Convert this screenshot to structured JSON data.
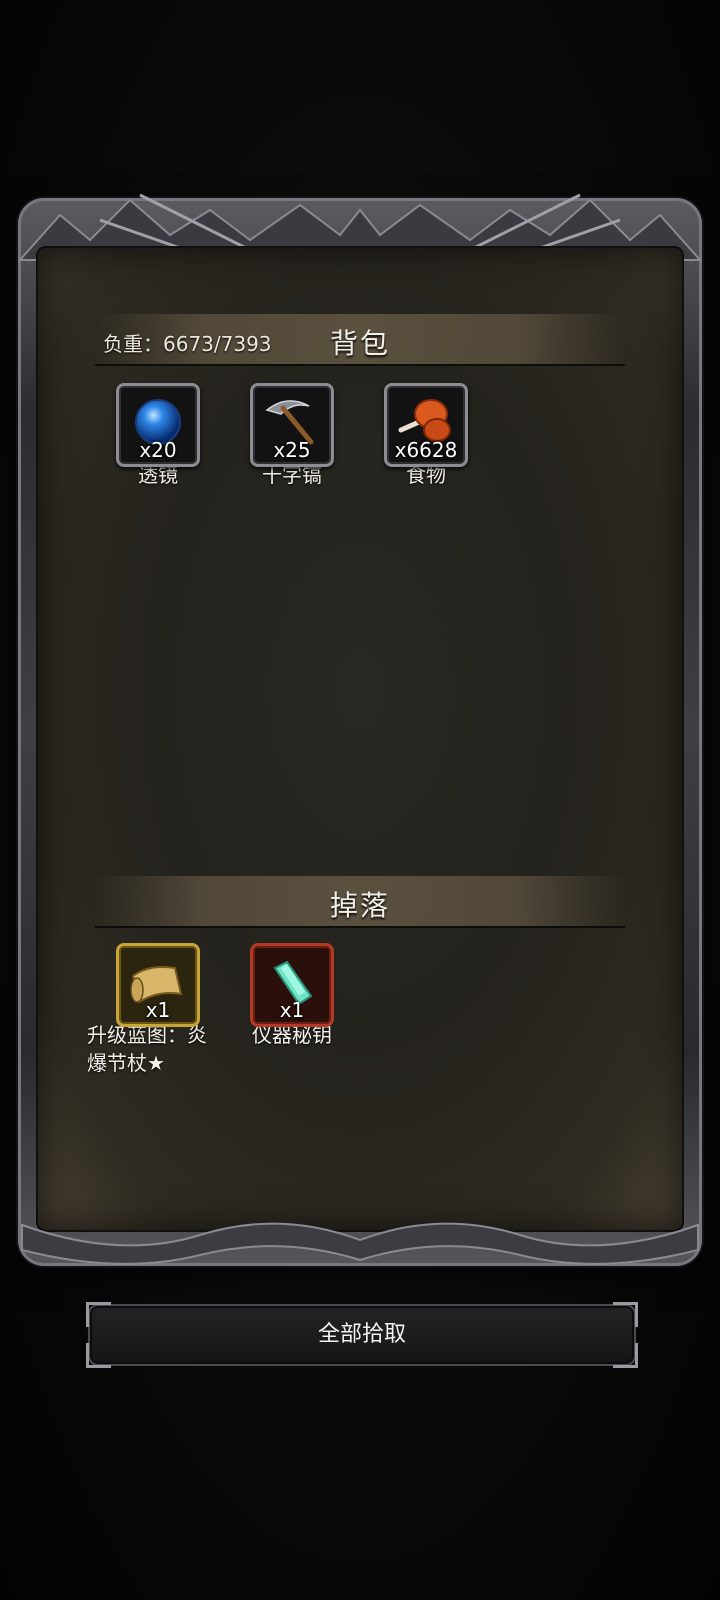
{
  "bag": {
    "weight_label": "负重：6673/7393",
    "title": "背包",
    "items": [
      {
        "name": "透镜",
        "count": "x20",
        "icon": "blue-orb-icon"
      },
      {
        "name": "十字镐",
        "count": "x25",
        "icon": "pickaxe-icon"
      },
      {
        "name": "食物",
        "count": "x6628",
        "icon": "meat-drumstick-icon"
      }
    ]
  },
  "drops": {
    "title": "掉落",
    "items": [
      {
        "name": "升级蓝图：炎爆节杖★",
        "count": "x1",
        "icon": "scroll-blueprint-icon",
        "rarity_color": "#c9a437"
      },
      {
        "name": "仪器秘钥",
        "count": "x1",
        "icon": "crystal-key-icon",
        "rarity_color": "#b03a24"
      }
    ]
  },
  "actions": {
    "collect_all_label": "全部拾取"
  },
  "colors": {
    "background": "#050505",
    "panel": "#24221d",
    "text": "#f4f1ea"
  }
}
